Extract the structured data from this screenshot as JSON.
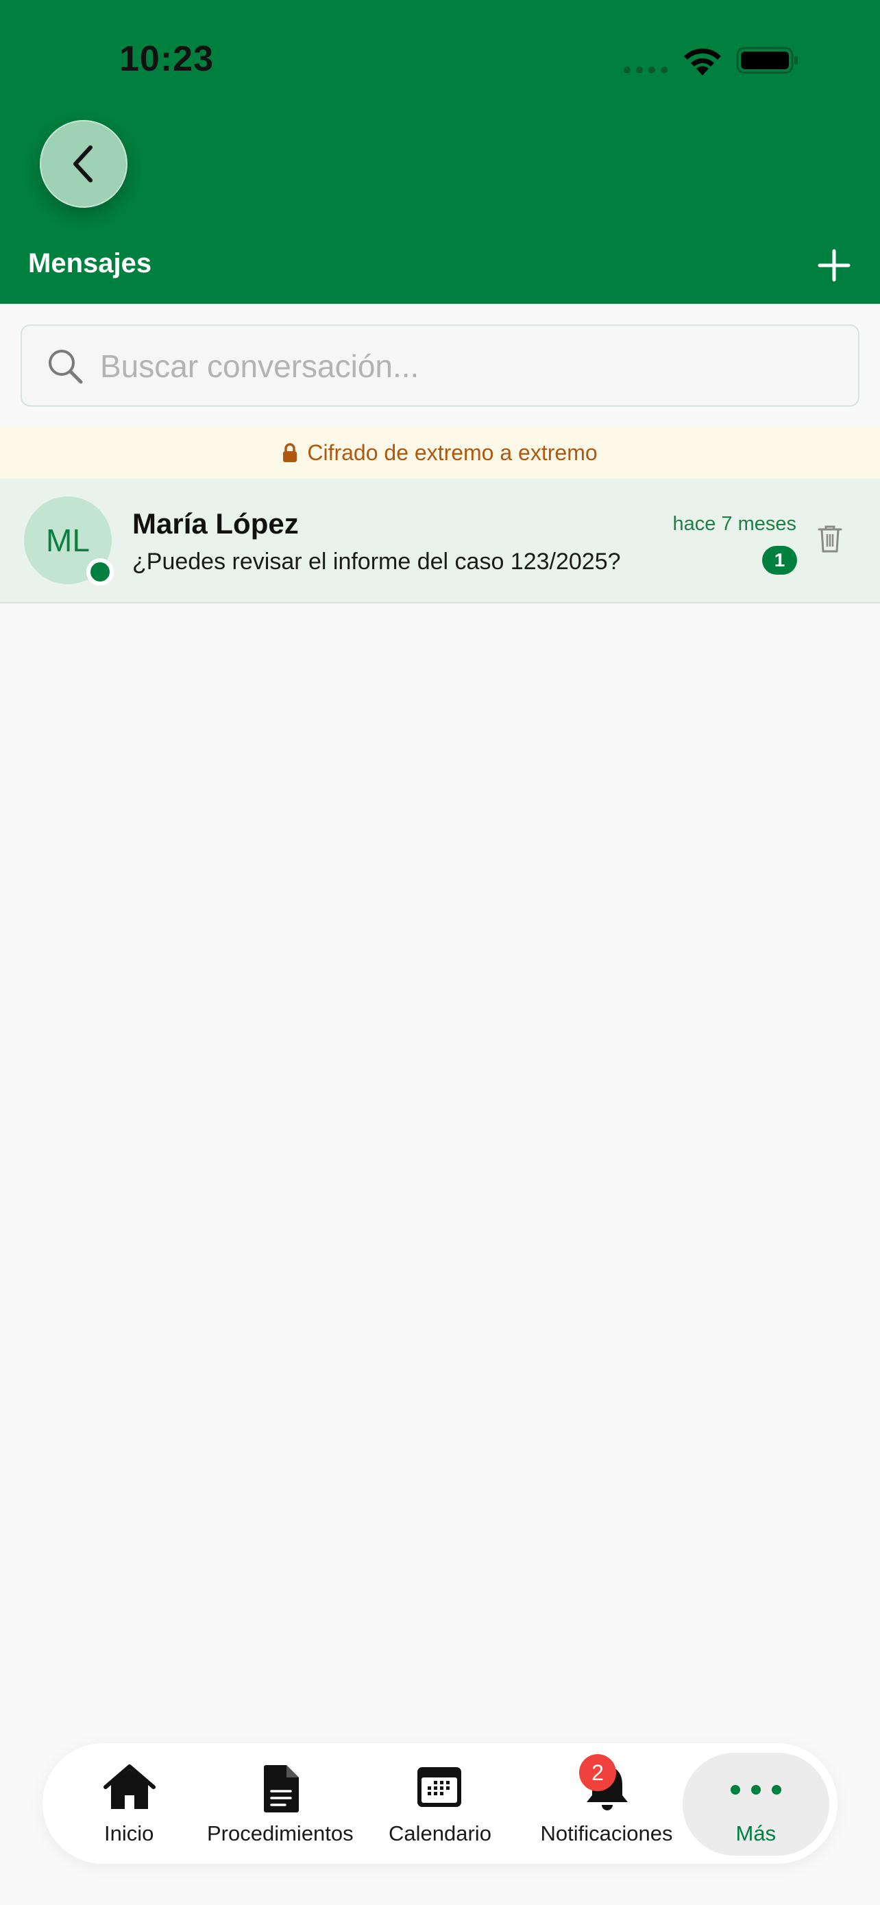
{
  "status_bar": {
    "time": "10:23"
  },
  "header": {
    "title": "Mensajes"
  },
  "search": {
    "placeholder": "Buscar conversación..."
  },
  "banner": {
    "text": "Cifrado de extremo a extremo"
  },
  "conversations": [
    {
      "initials": "ML",
      "name": "María López",
      "preview": "¿Puedes revisar el informe del caso 123/2025?",
      "time": "hace 7 meses",
      "unread": "1",
      "online": true
    }
  ],
  "tabs": [
    {
      "label": "Inicio",
      "icon": "home-icon"
    },
    {
      "label": "Procedimientos",
      "icon": "document-icon"
    },
    {
      "label": "Calendario",
      "icon": "calendar-icon"
    },
    {
      "label": "Notificaciones",
      "icon": "bell-icon",
      "badge": "2"
    },
    {
      "label": "Más",
      "icon": "more-icon",
      "active": true
    }
  ],
  "colors": {
    "brand_green": "#00803f",
    "banner_text": "#b0580e",
    "badge_red": "#f0413d"
  }
}
